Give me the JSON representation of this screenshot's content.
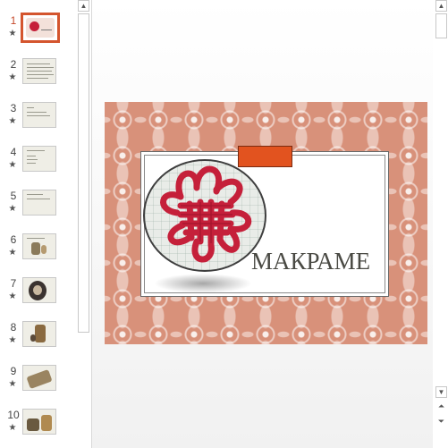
{
  "thumbnail_pane": {
    "slides": [
      {
        "number": "1",
        "active": true
      },
      {
        "number": "2",
        "active": false
      },
      {
        "number": "3",
        "active": false
      },
      {
        "number": "4",
        "active": false
      },
      {
        "number": "5",
        "active": false
      },
      {
        "number": "6",
        "active": false
      },
      {
        "number": "7",
        "active": false
      },
      {
        "number": "8",
        "active": false
      },
      {
        "number": "9",
        "active": false
      },
      {
        "number": "10",
        "active": false
      }
    ],
    "star_glyph": "★"
  },
  "slide": {
    "title": "МАКРАМЕ"
  },
  "colors": {
    "accent": "#e2531f",
    "pattern_background": "#d8917a",
    "knot_red": "#c5203a",
    "active_thumb_border": "#d4552e"
  },
  "scroll_glyphs": {
    "up": "▲",
    "down": "▼",
    "prev_slide": "⏶",
    "next_slide": "⏷"
  }
}
